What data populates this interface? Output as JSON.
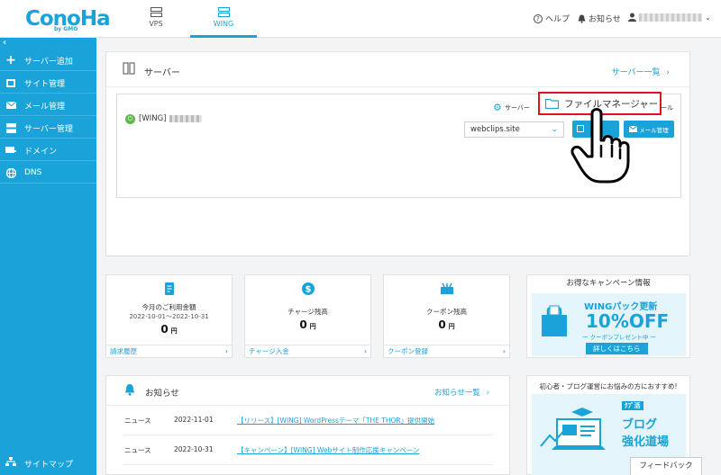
{
  "header": {
    "logo": "ConoHa",
    "logo_sub": "by GMO",
    "tabs": [
      {
        "label": "VPS",
        "icon": "server-stack-icon"
      },
      {
        "label": "WING",
        "icon": "server-stack-icon",
        "active": true
      }
    ],
    "help_label": "ヘルプ",
    "notice_label": "お知らせ"
  },
  "sidebar": {
    "collapse_glyph": "‹",
    "items": [
      {
        "label": "サーバー追加",
        "icon": "plus-icon"
      },
      {
        "label": "サイト管理",
        "icon": "window-icon"
      },
      {
        "label": "メール管理",
        "icon": "mail-icon"
      },
      {
        "label": "サーバー管理",
        "icon": "server-icon"
      },
      {
        "label": "ドメイン",
        "icon": "domain-icon"
      },
      {
        "label": "DNS",
        "icon": "globe-icon"
      }
    ],
    "footer_label": "サイトマップ"
  },
  "server_panel": {
    "title": "サーバー",
    "list_link": "サーバー一覧",
    "server_label": "[WING]",
    "settings_label": "サーバー",
    "mail_label": "ール",
    "domain_select": "webclips.site",
    "mail_button": "メール管理",
    "callout_label": "ファイルマネージャー"
  },
  "cards": [
    {
      "title": "今月のご利用金額",
      "sub": "2022-10-01～2022-10-31",
      "value": "0",
      "unit": "円",
      "footer": "請求履歴",
      "icon": "invoice-icon"
    },
    {
      "title": "チャージ残高",
      "value": "0",
      "unit": "円",
      "footer": "チャージ入金",
      "icon": "dollar-icon"
    },
    {
      "title": "クーポン残高",
      "value": "0",
      "unit": "円",
      "footer": "クーポン登録",
      "icon": "coupon-icon"
    }
  ],
  "campaign": {
    "heading": "お得なキャンペーン情報",
    "line1": "WINGパック更新",
    "line2": "10%OFF",
    "line3": "ー クーポンプレゼント中 ー",
    "line4": "詳しくはこちら"
  },
  "notice": {
    "title": "お知らせ",
    "list_link": "お知らせ一覧",
    "rows": [
      {
        "category": "ニュース",
        "date": "2022-11-01",
        "text": "【リリース】[WING] WordPressテーマ「THE THOR」提供開始"
      },
      {
        "category": "ニュース",
        "date": "2022-10-31",
        "text": "【キャンペーン】[WING] Webサイト制作応援キャンペーン"
      }
    ]
  },
  "blog": {
    "heading": "初心者・ブログ運営にお悩みの方におすすめ!",
    "tag": "ｸﾌﾞ活",
    "line1": "ブログ",
    "line2": "強化道場"
  },
  "feedback_label": "フィードバック",
  "colors": {
    "accent": "#1aa3d9",
    "highlight": "#e0141b",
    "power": "#5fb74d"
  }
}
